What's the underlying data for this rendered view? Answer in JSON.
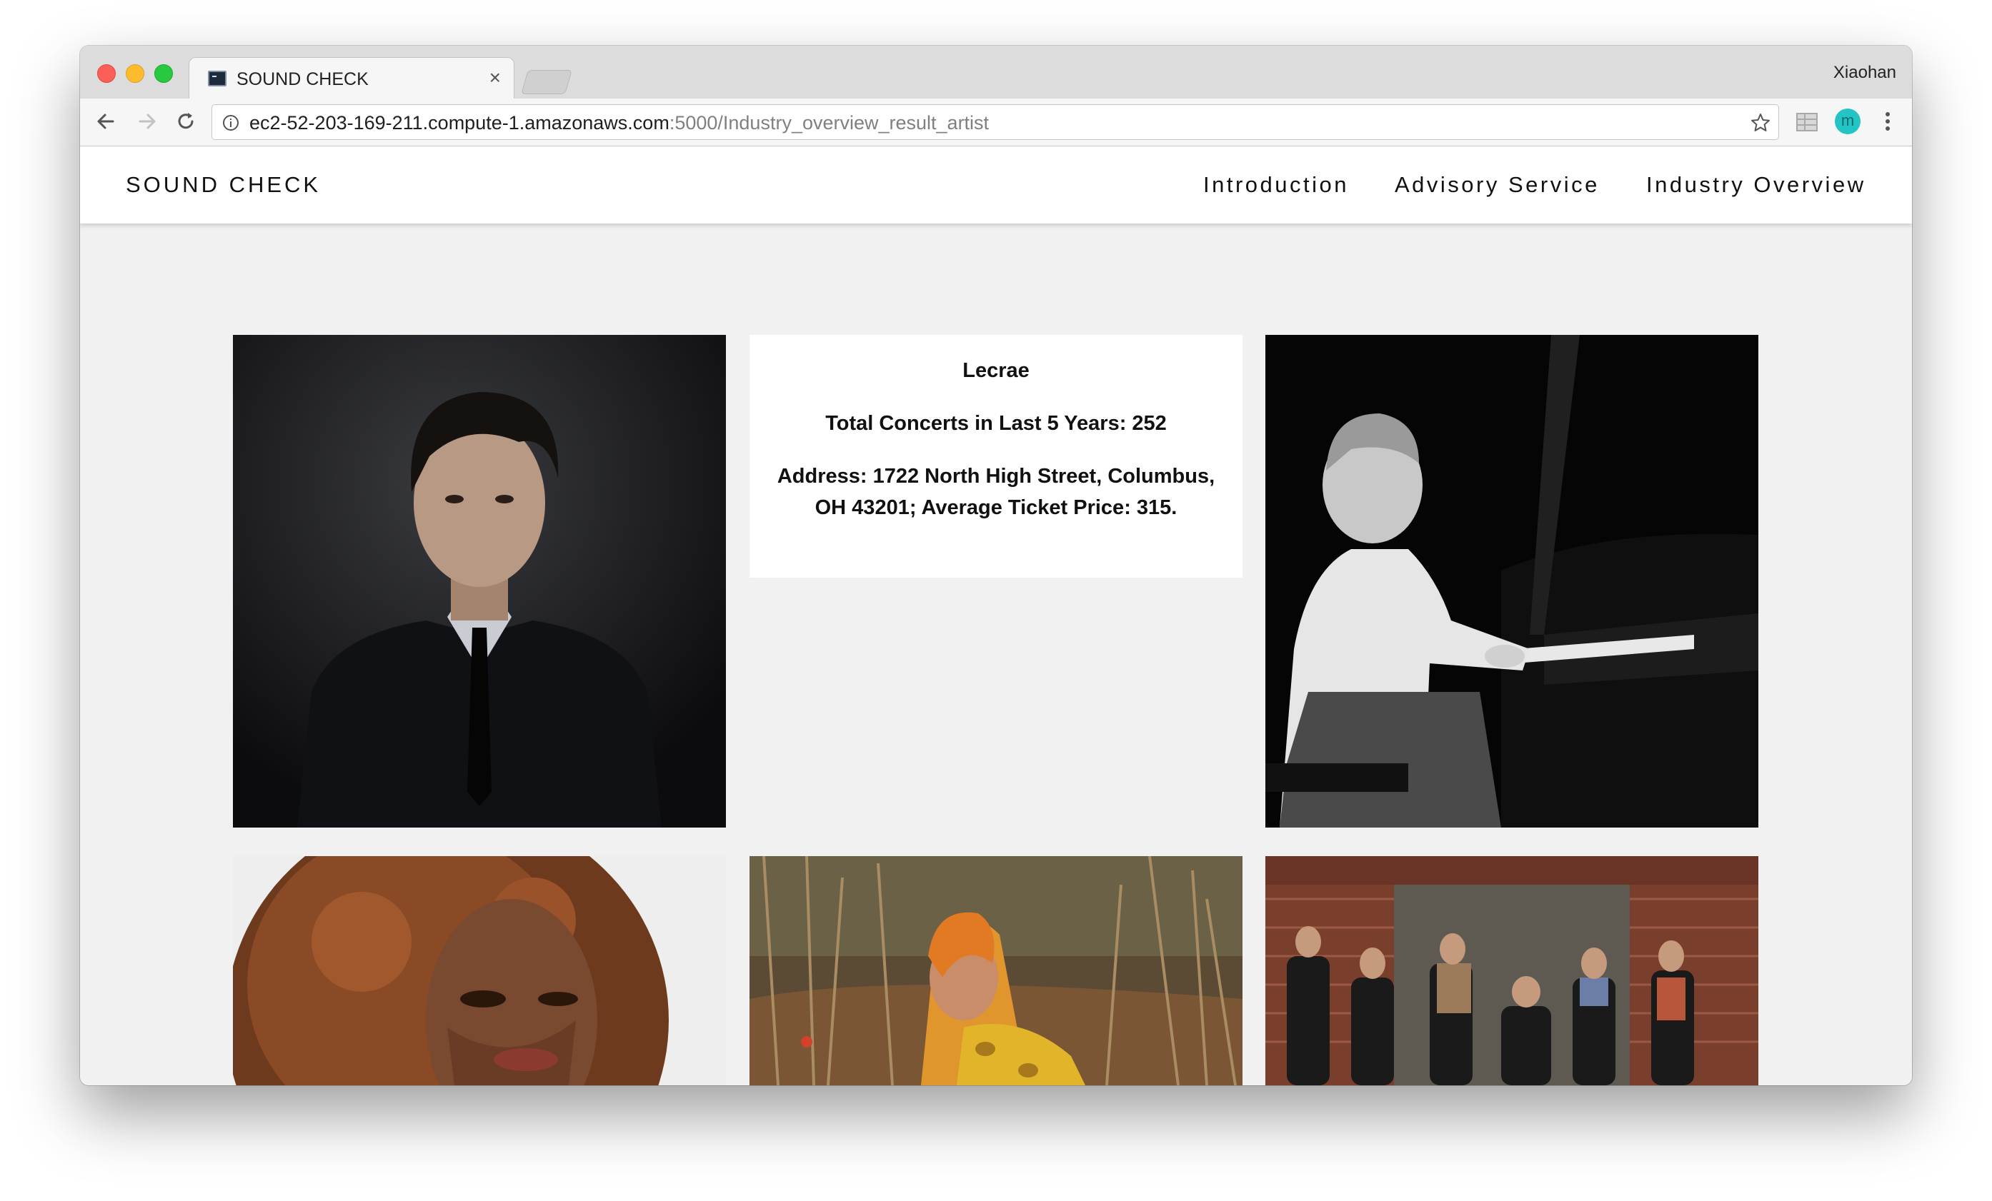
{
  "browser": {
    "tab_title": "SOUND CHECK",
    "tab_close": "×",
    "profile_name": "Xiaohan",
    "url_host": "ec2-52-203-169-211.compute-1.amazonaws.com",
    "url_path": ":5000/Industry_overview_result_artist",
    "extension_badge": "m"
  },
  "site": {
    "brand": "SOUND CHECK",
    "nav": [
      "Introduction",
      "Advisory Service",
      "Industry Overview"
    ]
  },
  "artist_card": {
    "name": "Lecrae",
    "concerts": "Total Concerts in Last 5 Years: 252",
    "address": "Address: 1722 North High Street, Columbus, OH 43201; Average Ticket Price: 315."
  },
  "colors": {
    "page_bg": "#f1f1f1",
    "card_bg": "#ffffff",
    "extension_teal": "#25c4c4"
  }
}
